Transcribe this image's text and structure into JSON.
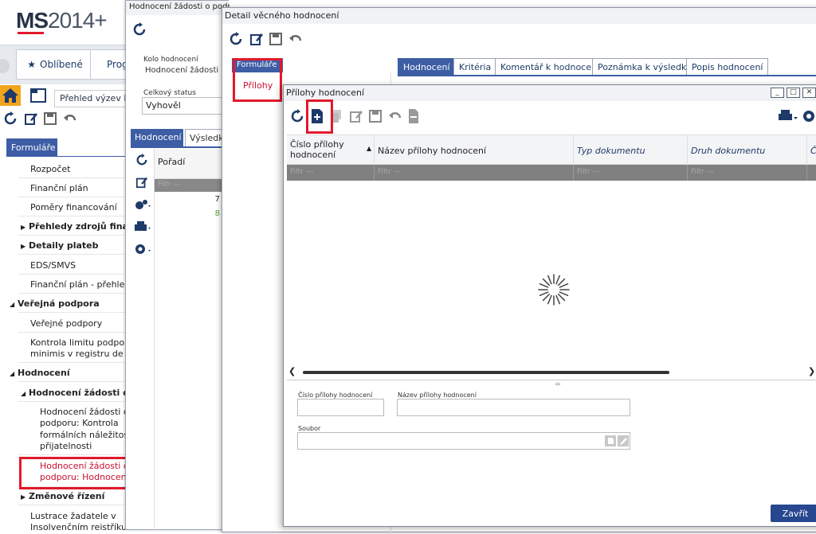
{
  "app": {
    "logo_bold": "MS",
    "logo_rest": "2014+",
    "nav": {
      "favorites": "Oblíbené",
      "programs": "Prog"
    },
    "breadcrumb": "Přehled výzev MA",
    "forms_tab": "Formuláře",
    "tree": [
      {
        "label": "Rozpočet"
      },
      {
        "label": "Finanční plán"
      },
      {
        "label": "Poměry financování"
      },
      {
        "label": "Přehledy zdrojů financov"
      },
      {
        "label": "Detaily plateb"
      },
      {
        "label": "EDS/SMVS"
      },
      {
        "label": "Finanční plán - přehled"
      },
      {
        "label": "Veřejná podpora"
      },
      {
        "label": "Veřejné podpory"
      },
      {
        "label": "Kontrola limitu podpory de"
      },
      {
        "label": "minimis v registru de min"
      },
      {
        "label": "Hodnocení"
      },
      {
        "label": "Hodnocení žádosti o pod"
      },
      {
        "label": "Hodnocení žádosti o"
      },
      {
        "label": "podporu: Kontrola"
      },
      {
        "label": "formálních náležitostí"
      },
      {
        "label": "přijatelnosti"
      },
      {
        "label": "Hodnocení žádosti o"
      },
      {
        "label": "podporu: Hodnocení vě"
      },
      {
        "label": "Změnové řízení"
      },
      {
        "label": "Lustrace žadatele v"
      },
      {
        "label": "Insolvenčním rejstříku"
      }
    ]
  },
  "window1": {
    "title": "Hodnocení žádosti o podporu: Hodnocení věcné",
    "kolo_label": "Kolo hodnocení",
    "kolo_value": "Hodnocení žádosti o po",
    "status_label": "Celkový status",
    "status_value": "Vyhověl",
    "tabs": [
      "Hodnocení",
      "Výsledky"
    ],
    "grid_header": "Pořadí",
    "filter": "Filtr ---",
    "rows": [
      "7",
      "8"
    ]
  },
  "window2": {
    "title": "Detail věcného hodnocení",
    "forms_tab": "Formuláře",
    "prilohy": "Přílohy",
    "tabs": [
      "Hodnocení",
      "Kritéria",
      "Komentář k hodnocení",
      "Poznámka k výsledku",
      "Popis hodnocení"
    ]
  },
  "window3": {
    "title": "Přílohy hodnocení",
    "columns": [
      "Číslo přílohy hodnocení",
      "Název přílohy hodnocení",
      "Typ dokumentu",
      "Druh dokumentu",
      "Č"
    ],
    "filter": "Filtr ---",
    "form": {
      "cislo_label": "Číslo přílohy hodnocení",
      "nazev_label": "Název přílohy hodnocení",
      "soubor_label": "Soubor"
    },
    "close_button": "Zavřít"
  },
  "colors": {
    "accent": "#3d5da5",
    "highlight": "#e2192b",
    "home": "#f2a41d"
  }
}
